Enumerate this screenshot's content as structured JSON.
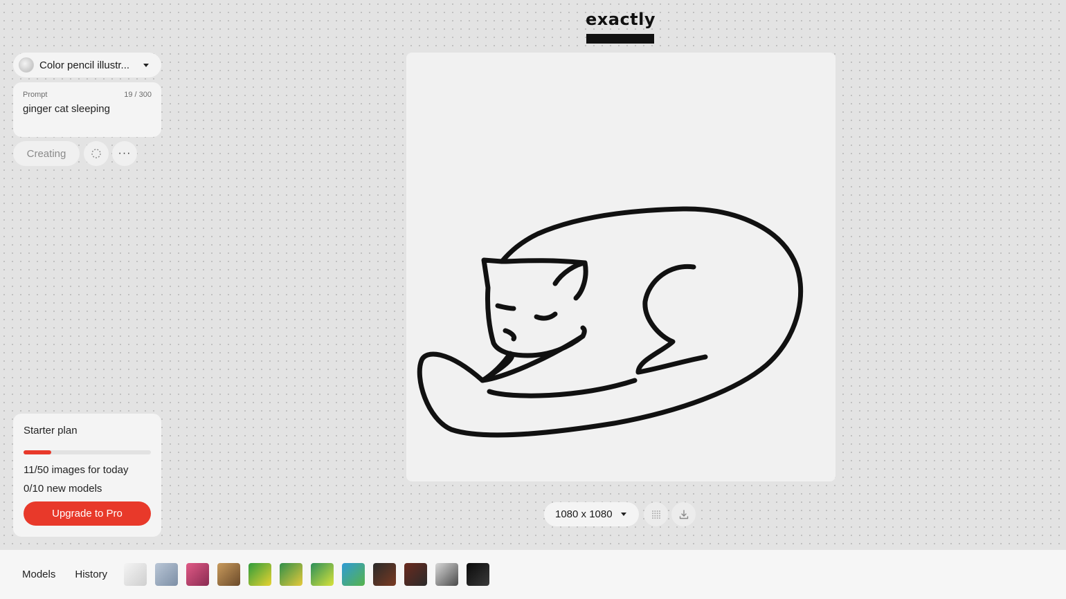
{
  "app": {
    "logo_text": "exactly"
  },
  "sidebar": {
    "model_select": {
      "label": "Color pencil illustr...",
      "thumb_icon": "model-thumbnail"
    },
    "prompt": {
      "label": "Prompt",
      "count": "19 / 300",
      "value": "ginger cat sleeping"
    },
    "actions": {
      "creating_label": "Creating",
      "spinner_icon": "loading-spinner-icon",
      "more_label": "···"
    }
  },
  "plan": {
    "title": "Starter plan",
    "progress": 0.22,
    "images_line": "11/50 images for today",
    "models_line": "0/10 new models",
    "upgrade_label": "Upgrade to Pro",
    "accent_color": "#e8392a"
  },
  "canvas": {
    "size_label": "1080 x 1080",
    "grid_icon": "grid-icon",
    "download_icon": "download-icon"
  },
  "bottom_bar": {
    "models_label": "Models",
    "history_label": "History",
    "thumbnails": [
      {
        "colors": [
          "#f4f4f4",
          "#cfcfcf"
        ]
      },
      {
        "colors": [
          "#b9c6d6",
          "#7d8fa6"
        ]
      },
      {
        "colors": [
          "#e05a86",
          "#8a2b52"
        ]
      },
      {
        "colors": [
          "#c89a5c",
          "#6b4a2a"
        ]
      },
      {
        "colors": [
          "#2f9c3c",
          "#e8d230"
        ]
      },
      {
        "colors": [
          "#2f8f4a",
          "#e6c93a"
        ]
      },
      {
        "colors": [
          "#2b8f5a",
          "#d9e23a"
        ]
      },
      {
        "colors": [
          "#2f9ad6",
          "#57b34a"
        ]
      },
      {
        "colors": [
          "#2a2a2a",
          "#7a3a22"
        ]
      },
      {
        "colors": [
          "#6b2a1e",
          "#2a2a2a"
        ]
      },
      {
        "colors": [
          "#d8d8d8",
          "#4a4a4a"
        ]
      },
      {
        "colors": [
          "#0a0a0a",
          "#3a3a3a"
        ]
      }
    ]
  }
}
